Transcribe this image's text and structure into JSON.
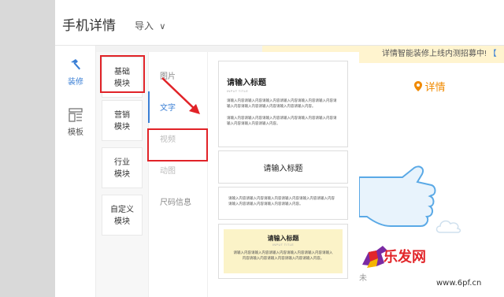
{
  "header": {
    "title": "手机详情",
    "import_label": "导入",
    "import_chevron": "∨"
  },
  "side_nav": {
    "items": [
      {
        "label": "装修",
        "icon": "hammer-icon",
        "active": true
      },
      {
        "label": "模板",
        "icon": "template-icon",
        "active": false
      }
    ]
  },
  "categories": [
    {
      "line1": "基础",
      "line2": "模块"
    },
    {
      "line1": "营销",
      "line2": "模块"
    },
    {
      "line1": "行业",
      "line2": "模块"
    },
    {
      "line1": "自定义",
      "line2": "模块"
    }
  ],
  "types": [
    {
      "label": "图片"
    },
    {
      "label": "文字"
    },
    {
      "label": "视频"
    },
    {
      "label": "动图"
    },
    {
      "label": "尺码信息"
    }
  ],
  "templates": {
    "tpl1": {
      "heading": "请输入标题",
      "sub": "INPUT TITLE",
      "para1": "请输入内容请输入内容请输入内容请输入内容请输入内容请输入内容请输入内容请输入内容请输入内容请输入内容请输入内容。",
      "para2": "请输入内容请输入内容请输入内容请输入内容请输入内容请输入内容请输入内容请输入内容请输入内容。"
    },
    "tpl2": {
      "heading": "请输入标题"
    },
    "tpl3": {
      "body": "请输入内容请输入内容请输入内容请输入内容请输入内容请输入内容请输入内容请输入内容请输入内容请输入内容。"
    },
    "tpl4": {
      "heading": "请输入标题",
      "sub": "INPUT TITLE",
      "body": "请输入内容请输入内容请输入内容请输入内容请输入内容请输入内容请输入内容请输入内容请输入内容请输入内容。"
    }
  },
  "notice": {
    "text": "详情智能装修上线内测招募中!",
    "bracket": "【"
  },
  "preview": {
    "detail_label": "详情",
    "hint": "未"
  },
  "watermark": {
    "logo": "乐发网",
    "url": "www.6pf.cn"
  },
  "colors": {
    "accent_blue": "#3a7fd5",
    "annotation_red": "#e12328",
    "notice_bg": "#fff4cf",
    "detail_orange": "#f08a00"
  }
}
